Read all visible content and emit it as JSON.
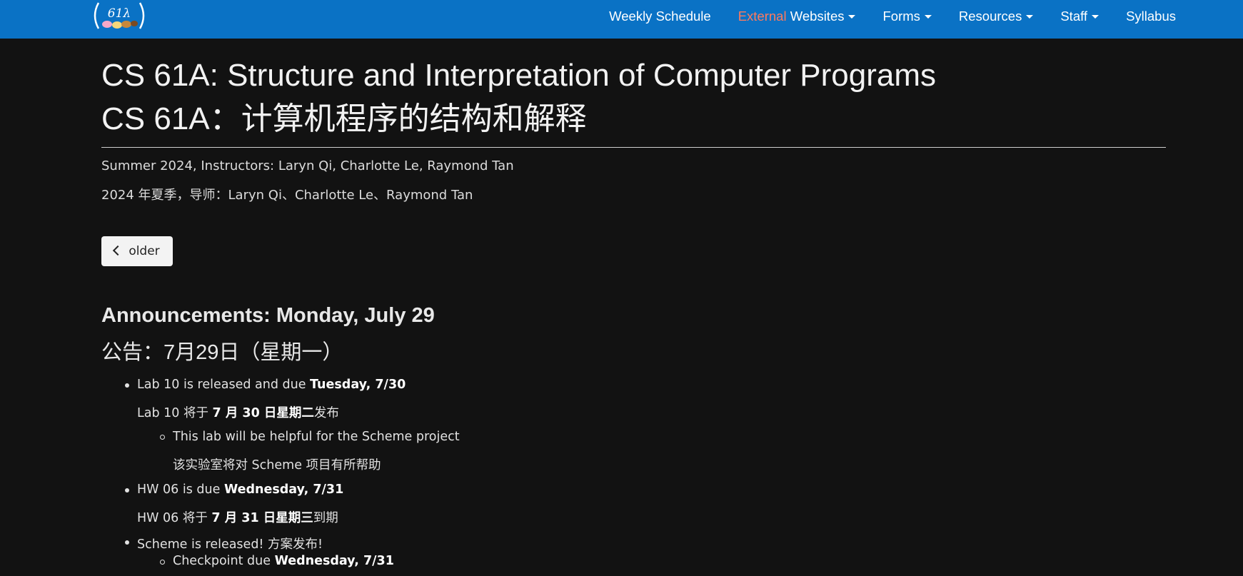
{
  "nav": {
    "logo_alt": "CS 61A logo",
    "items": [
      {
        "label": "Weekly Schedule",
        "dropdown": false
      },
      {
        "label_accent": "External",
        "label": " Websites",
        "dropdown": true
      },
      {
        "label": "Forms",
        "dropdown": true
      },
      {
        "label": "Resources",
        "dropdown": true
      },
      {
        "label": "Staff",
        "dropdown": true
      },
      {
        "label": "Syllabus",
        "dropdown": false
      }
    ]
  },
  "header": {
    "title_en": "CS 61A: Structure and Interpretation of Computer Programs",
    "title_cn": "CS 61A：计算机程序的结构和解释",
    "subtitle_en": "Summer 2024, Instructors: Laryn Qi, Charlotte Le, Raymond Tan",
    "subtitle_cn": "2024 年夏季，导师：Laryn Qi、Charlotte Le、Raymond Tan"
  },
  "pager": {
    "older_label": "older"
  },
  "announcement": {
    "title_en": "Announcements: Monday, July 29",
    "title_cn": "公告：7月29日（星期一）",
    "items": {
      "lab_en_pre": "Lab 10 is released and due ",
      "lab_en_bold": "Tuesday, 7/30",
      "lab_cn_pre": "Lab 10 将于 ",
      "lab_cn_bold": "7 月 30 日星期二",
      "lab_cn_post": "发布",
      "lab_sub_en": "This lab will be helpful for the Scheme project",
      "lab_sub_cn": "该实验室将对 Scheme 项目有所帮助",
      "hw_en_pre": "HW 06 is due ",
      "hw_en_bold": "Wednesday, 7/31",
      "hw_cn_pre": "HW 06 将于 ",
      "hw_cn_bold": "7 月 31 日星期三",
      "hw_cn_post": "到期",
      "scheme_en": "Scheme is released! 方案发布!",
      "checkpoint_pre": "Checkpoint due ",
      "checkpoint_bold": "Wednesday, 7/31"
    }
  },
  "colors": {
    "navbar": "#0a72c5",
    "accent": "#ff7a5e",
    "background": "#121212"
  }
}
